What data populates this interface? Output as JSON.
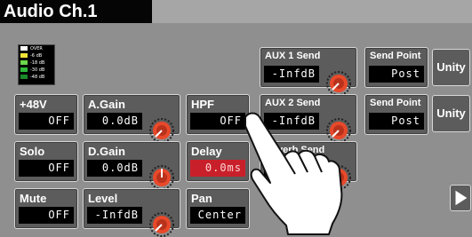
{
  "title": "Audio Ch.1",
  "meter": {
    "levels": [
      "OVER",
      "-6 dB",
      "-18 dB",
      "-30 dB",
      "-48 dB"
    ],
    "colors": [
      "#ffffff",
      "#f2e23a",
      "#6bd64b",
      "#2fb93a",
      "#1a8a2a"
    ]
  },
  "controls": {
    "plus48v": {
      "label": "+48V",
      "value": "OFF"
    },
    "solo": {
      "label": "Solo",
      "value": "OFF"
    },
    "mute": {
      "label": "Mute",
      "value": "OFF"
    },
    "again": {
      "label": "A.Gain",
      "value": "0.0dB"
    },
    "dgain": {
      "label": "D.Gain",
      "value": "0.0dB"
    },
    "level": {
      "label": "Level",
      "value": "-InfdB"
    },
    "hpf": {
      "label": "HPF",
      "value": "OFF"
    },
    "delay": {
      "label": "Delay",
      "value": "0.0ms"
    },
    "pan": {
      "label": "Pan",
      "value": "Center"
    },
    "aux1": {
      "label": "AUX 1 Send",
      "value": "-InfdB"
    },
    "aux2": {
      "label": "AUX 2 Send",
      "value": "-InfdB"
    },
    "reverb": {
      "label": "Reverb Send",
      "value": "0"
    },
    "sendpoint1": {
      "label": "Send Point",
      "value": "Post"
    },
    "sendpoint2": {
      "label": "Send Point",
      "value": "Post"
    },
    "unity1": "Unity",
    "unity2": "Unity"
  },
  "icons": {
    "knob": "knob-icon",
    "next": "next-arrow-icon",
    "hand": "pointing-hand-icon"
  },
  "colors": {
    "accent_knob": "#e8492a",
    "delay_value_bg": "#c8202a"
  }
}
